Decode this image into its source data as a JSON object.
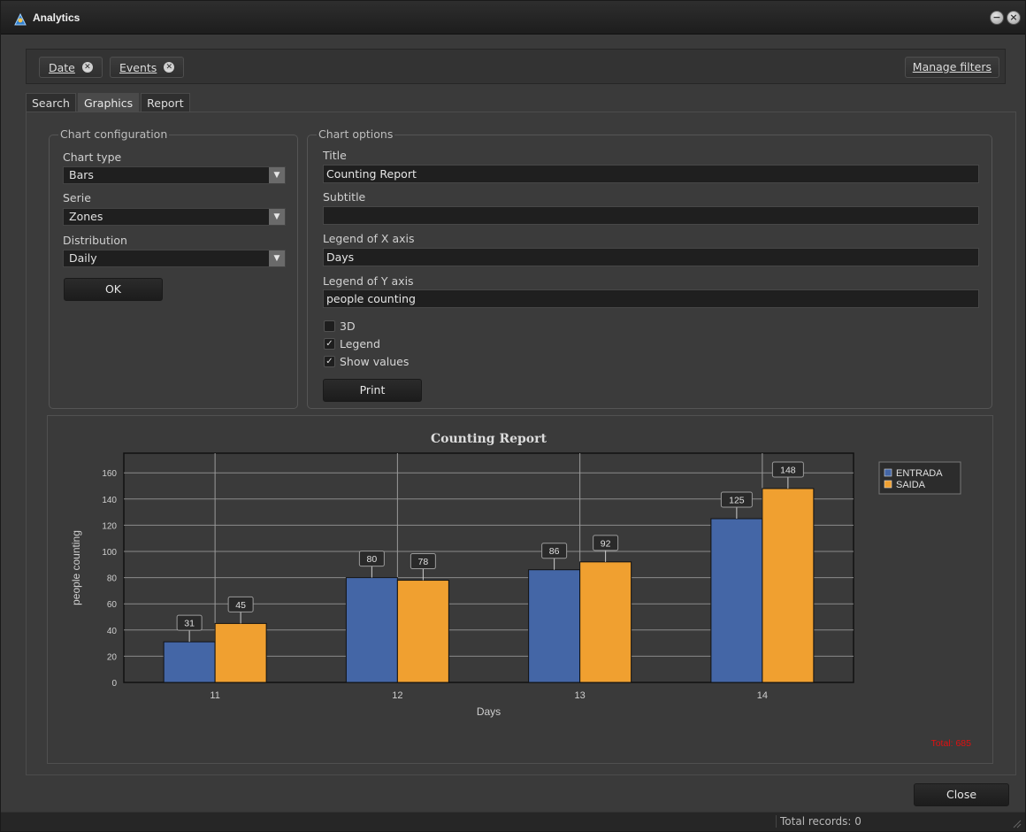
{
  "window": {
    "title": "Analytics"
  },
  "filters": {
    "chips": [
      {
        "label": "Date"
      },
      {
        "label": "Events"
      }
    ],
    "manage_label": "Manage filters"
  },
  "tabs": [
    {
      "label": "Search",
      "active": false
    },
    {
      "label": "Graphics",
      "active": true
    },
    {
      "label": "Report",
      "active": false
    }
  ],
  "chart_configuration": {
    "legend": "Chart configuration",
    "chart_type_label": "Chart type",
    "chart_type_value": "Bars",
    "serie_label": "Serie",
    "serie_value": "Zones",
    "distribution_label": "Distribution",
    "distribution_value": "Daily",
    "ok_label": "OK"
  },
  "chart_options": {
    "legend": "Chart options",
    "title_label": "Title",
    "title_value": "Counting Report",
    "subtitle_label": "Subtitle",
    "subtitle_value": "",
    "xaxis_label": "Legend of X axis",
    "xaxis_value": "Days",
    "yaxis_label": "Legend of Y axis",
    "yaxis_value": "people counting",
    "opt_3d_label": "3D",
    "opt_3d_checked": false,
    "opt_legend_label": "Legend",
    "opt_legend_checked": true,
    "opt_values_label": "Show values",
    "opt_values_checked": true,
    "print_label": "Print"
  },
  "chart_data": {
    "type": "bar",
    "title": "Counting Report",
    "xlabel": "Days",
    "ylabel": "people counting",
    "categories": [
      "11",
      "12",
      "13",
      "14"
    ],
    "series": [
      {
        "name": "ENTRADA",
        "color": "#4466a6",
        "values": [
          31,
          80,
          86,
          125
        ]
      },
      {
        "name": "SAIDA",
        "color": "#f0a030",
        "values": [
          45,
          78,
          92,
          148
        ]
      }
    ],
    "ylim": [
      0,
      175
    ],
    "yticks": [
      0,
      20,
      40,
      60,
      80,
      100,
      120,
      140,
      160
    ],
    "grid": true,
    "legend_position": "top-right",
    "total_text": "Total: 685",
    "total_color": "#e01010"
  },
  "footer": {
    "close_label": "Close",
    "status_text": "Total records: 0"
  }
}
